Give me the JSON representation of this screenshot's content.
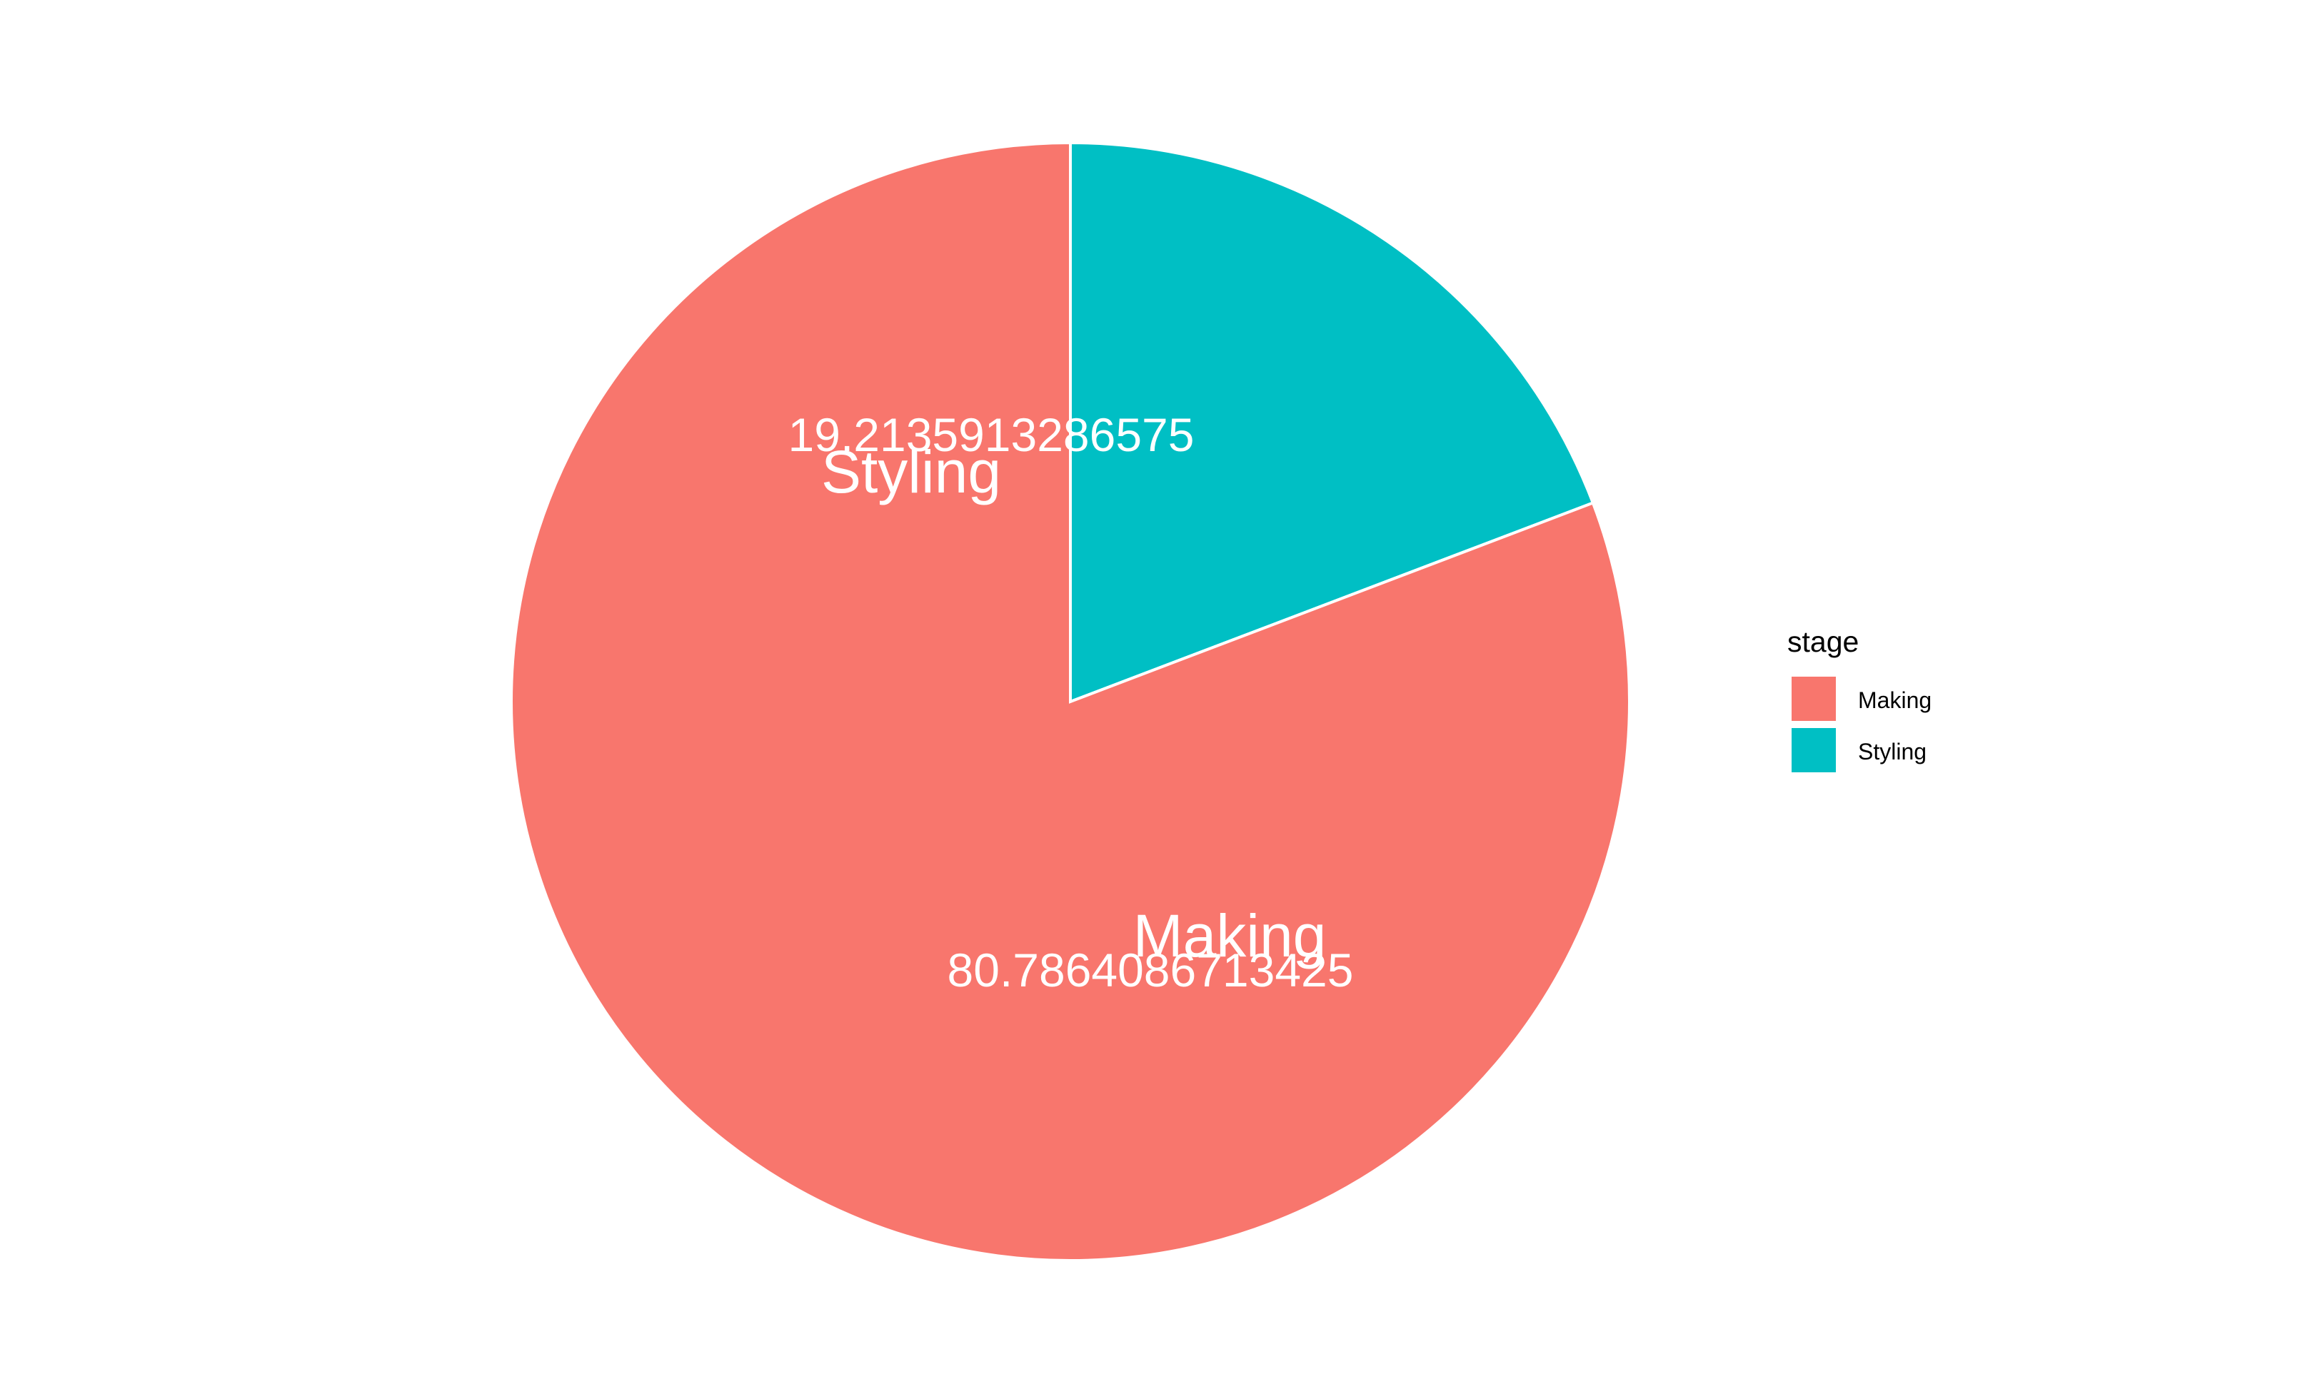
{
  "chart_data": {
    "type": "pie",
    "title": "",
    "slices": [
      {
        "label": "Styling",
        "value": 19.2135913286575,
        "value_text": "19.2135913286575",
        "color": "#00BFC4"
      },
      {
        "label": "Making",
        "value": 80.7864086713425,
        "value_text": "80.7864086713425",
        "color": "#F8766D"
      }
    ],
    "start": "top",
    "direction": "clockwise",
    "legend": {
      "title": "stage",
      "position": "right",
      "items": [
        {
          "label": "Making",
          "color": "#F8766D"
        },
        {
          "label": "Styling",
          "color": "#00BFC4"
        }
      ]
    }
  }
}
